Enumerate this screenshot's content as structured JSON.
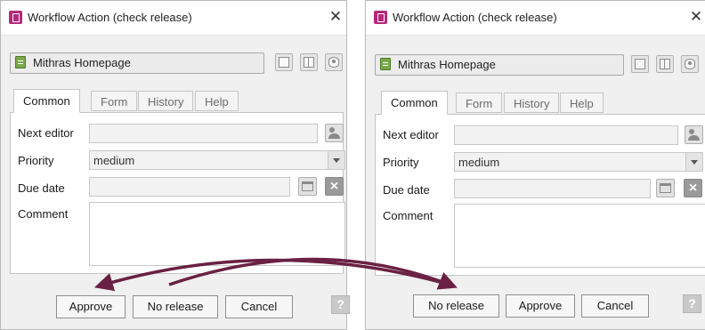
{
  "dialogs": [
    {
      "title": "Workflow Action (check release)",
      "close_glyph": "✕",
      "page_name": "Mithras Homepage",
      "tabs": [
        "Common",
        "Form",
        "History",
        "Help"
      ],
      "fields": {
        "next_editor_label": "Next editor",
        "next_editor_value": "",
        "priority_label": "Priority",
        "priority_value": "medium",
        "due_date_label": "Due date",
        "due_date_value": "",
        "comment_label": "Comment",
        "comment_value": ""
      },
      "buttons": [
        "Approve",
        "No release",
        "Cancel"
      ],
      "help_glyph": "?"
    },
    {
      "title": "Workflow Action (check release)",
      "close_glyph": "✕",
      "page_name": "Mithras Homepage",
      "tabs": [
        "Common",
        "Form",
        "History",
        "Help"
      ],
      "fields": {
        "next_editor_label": "Next editor",
        "next_editor_value": "",
        "priority_label": "Priority",
        "priority_value": "medium",
        "due_date_label": "Due date",
        "due_date_value": "",
        "comment_label": "Comment",
        "comment_value": ""
      },
      "buttons": [
        "No release",
        "Approve",
        "Cancel"
      ],
      "help_glyph": "?"
    }
  ],
  "icons": {
    "app": "workflow-app-icon",
    "page": "page-icon",
    "toolbar": [
      "form-view-icon",
      "split-view-icon",
      "preview-icon"
    ],
    "next_editor": "user-select-icon",
    "due_date": "calendar-icon",
    "clear": "clear-date-icon"
  },
  "colors": {
    "app_icon": "#b7287a",
    "page_icon": "#7aa84a",
    "arrow": "#6a2143",
    "dialog_bg": "#f0f0f0"
  }
}
